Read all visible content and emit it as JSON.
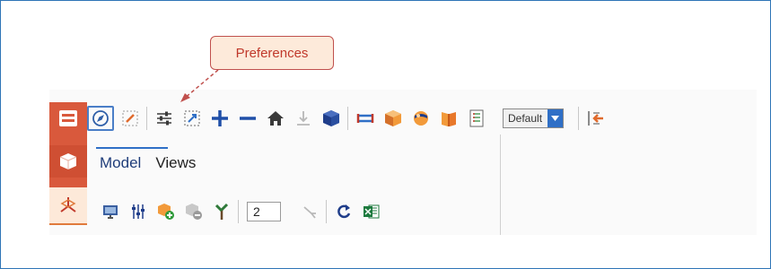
{
  "callout": {
    "text": "Preferences"
  },
  "toolbar": {
    "rail": [
      "header-icon",
      "cube-icon",
      "axes-icon"
    ],
    "row1": [
      "compass-icon",
      "edit-icon",
      "sliders-icon",
      "zoom-box-icon",
      "plus-icon",
      "minus-icon",
      "home-icon",
      "download-icon",
      "cube-icon",
      "measure-icon",
      "section-box-icon",
      "sphere-icon",
      "book-icon",
      "notes-icon"
    ],
    "display_style": "Default",
    "exit_icon": "exit-icon"
  },
  "panel": {
    "tabs": [
      "Model",
      "Views"
    ],
    "active_tab": "Model",
    "row2": [
      "monitor-icon",
      "sliders-vertical-icon",
      "add-cube-icon",
      "remove-cube-icon",
      "tree-icon"
    ],
    "level_value": "2",
    "row2b": [
      "disabled-fork-icon",
      "refresh-icon",
      "excel-icon"
    ]
  },
  "colors": {
    "rail": "#d9593c",
    "accent": "#2f6fc6",
    "callout_border": "#c0504d",
    "callout_text": "#c0392b",
    "frame": "#2e75b6"
  }
}
